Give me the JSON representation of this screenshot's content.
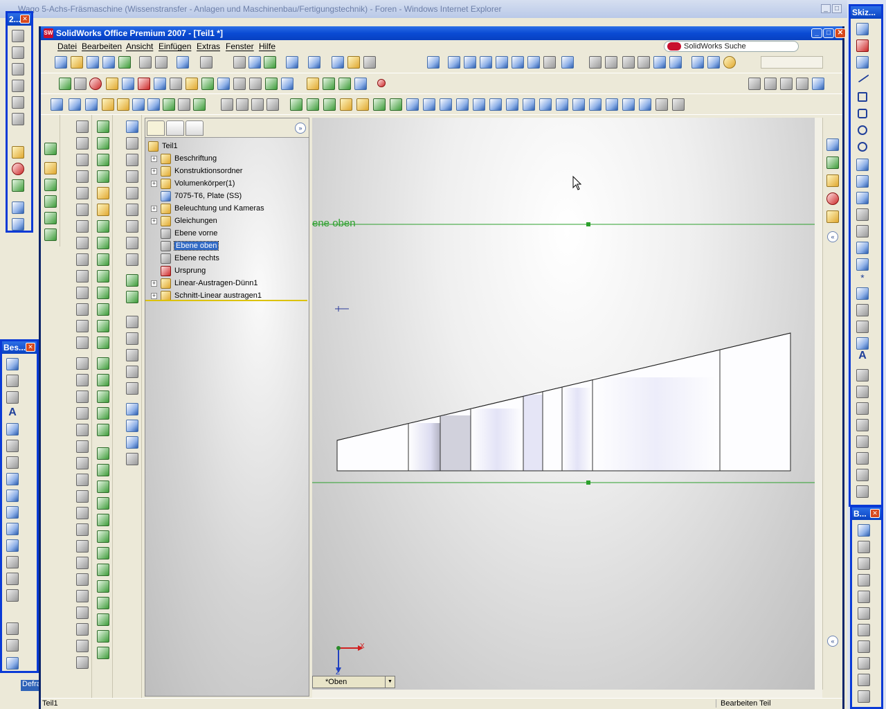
{
  "ie": {
    "title": "Wago 5-Achs-Fräsmaschine (Wissenstransfer - Anlagen und Maschinenbau/Fertigungstechnik) - Foren - Windows Internet Explorer"
  },
  "sw": {
    "title": "SolidWorks Office Premium 2007 - [Teil1 *]",
    "logo_text": "SW",
    "menu": [
      "Datei",
      "Bearbeiten",
      "Ansicht",
      "Einfügen",
      "Extras",
      "Fenster",
      "Hilfe"
    ],
    "search_placeholder": "SolidWorks Suche"
  },
  "tree": {
    "root": "Teil1",
    "items": [
      {
        "label": "Beschriftung",
        "icon": "annotation-icon",
        "expand": true
      },
      {
        "label": "Konstruktionsordner",
        "icon": "design-binder-icon",
        "expand": true
      },
      {
        "label": "Volumenkörper(1)",
        "icon": "solid-bodies-icon",
        "expand": true
      },
      {
        "label": "7075-T6, Plate (SS)",
        "icon": "material-icon",
        "expand": false
      },
      {
        "label": "Beleuchtung und Kameras",
        "icon": "lights-cameras-icon",
        "expand": true
      },
      {
        "label": "Gleichungen",
        "icon": "equations-icon",
        "expand": true
      },
      {
        "label": "Ebene vorne",
        "icon": "plane-icon",
        "expand": false
      },
      {
        "label": "Ebene oben",
        "icon": "plane-icon",
        "expand": false,
        "selected": true
      },
      {
        "label": "Ebene rechts",
        "icon": "plane-icon",
        "expand": false
      },
      {
        "label": "Ursprung",
        "icon": "origin-icon",
        "expand": false
      },
      {
        "label": "Linear-Austragen-Dünn1",
        "icon": "extrude-icon",
        "expand": true
      },
      {
        "label": "Schnitt-Linear austragen1",
        "icon": "cut-extrude-icon",
        "expand": true
      }
    ]
  },
  "viewport": {
    "plane_label": "ene oben",
    "view_name": "*Oben",
    "axis_x": "X",
    "axis_z": "Z"
  },
  "status": {
    "left": "Teil1",
    "right": "Bearbeiten Teil"
  },
  "palettes": {
    "top_left": "2...",
    "left": "Bes...",
    "right_top": "Skiz...",
    "right_bottom": "B..."
  },
  "desktop": {
    "label": "Defra"
  },
  "colors": {
    "title_blue": "#0a4bd4",
    "selection": "#316ac5",
    "plane_green": "#2ca02c"
  }
}
